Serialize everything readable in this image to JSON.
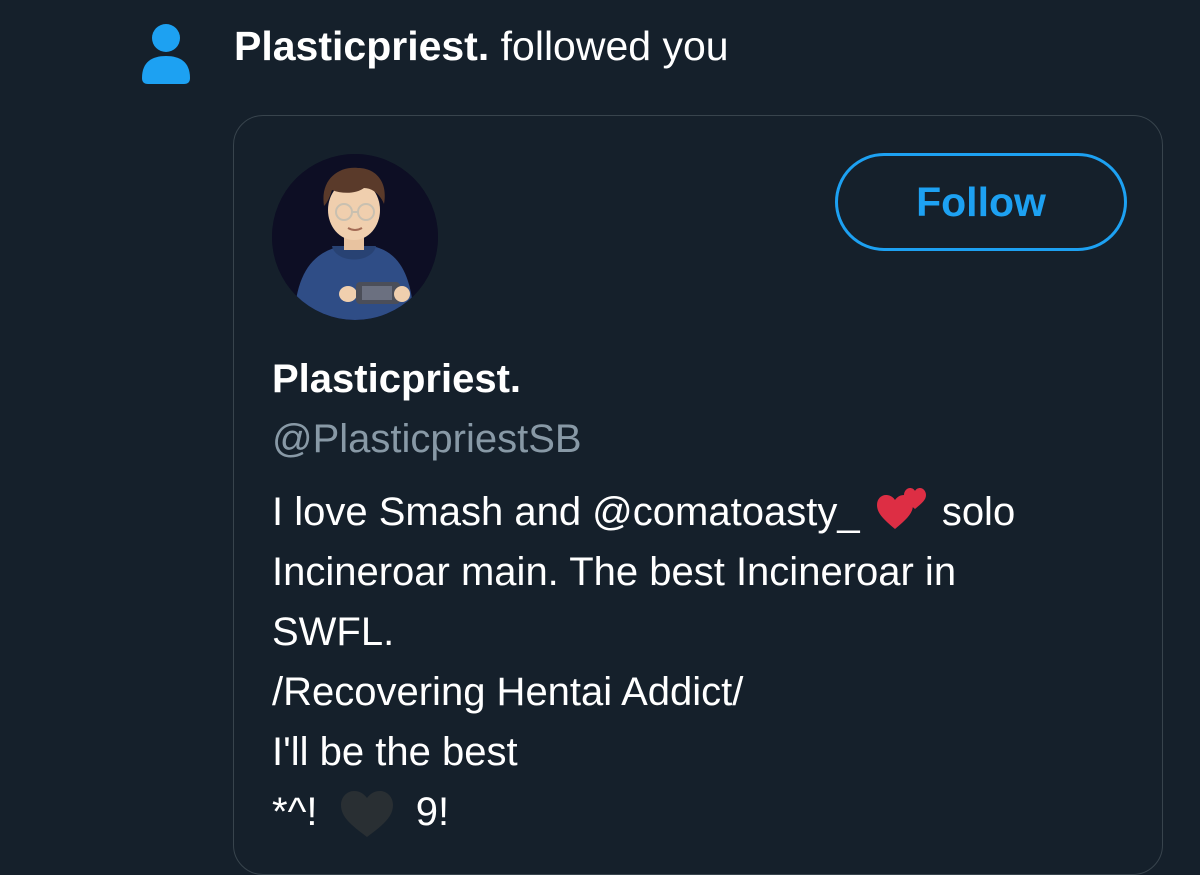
{
  "notification": {
    "icon": "person-icon",
    "follower_name": "Plasticpriest.",
    "action_text": "followed you",
    "icon_color": "#1da1f2"
  },
  "user_card": {
    "avatar": "avatar-image",
    "follow_button_label": "Follow",
    "display_name": "Plasticpriest.",
    "handle": "@PlasticpriestSB",
    "bio": {
      "line1_part1": "I love Smash and @comatoasty_",
      "line1_emoji": "two-hearts-icon",
      "line1_part2": "solo",
      "line2": "Incineroar main. The best Incineroar in",
      "line3": "SWFL.",
      "line4": "/Recovering Hentai Addict/",
      "line5": "I'll be the best",
      "line6_part1": "*^!",
      "line6_emoji": "black-heart-icon",
      "line6_part2": "9!"
    }
  },
  "colors": {
    "background": "#15202b",
    "accent": "#1da1f2",
    "border": "#38444d",
    "secondary_text": "#8899a6",
    "primary_text": "#ffffff"
  }
}
